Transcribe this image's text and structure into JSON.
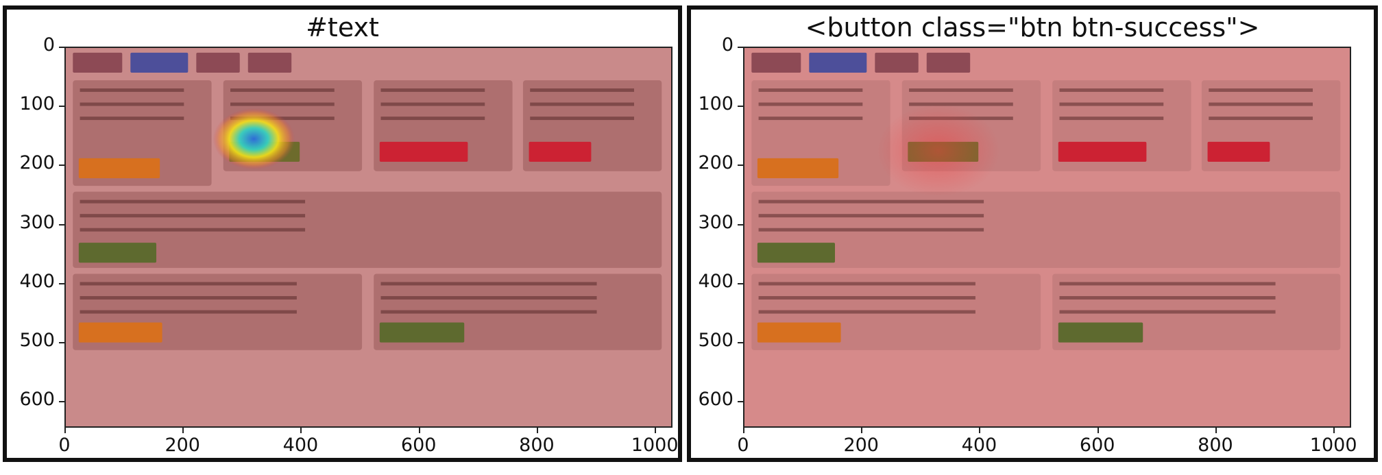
{
  "panels": [
    {
      "title": "#text",
      "tint": "#c98a8a",
      "card_fill": "#a96a6a",
      "hotspot": {
        "x": 320,
        "y": 155,
        "strength": "strong"
      }
    },
    {
      "title": "<button class=\"btn btn-success\">",
      "tint": "#d68a8a",
      "card_fill": "#c27b7b",
      "hotspot": {
        "x": 330,
        "y": 175,
        "strength": "faint"
      }
    }
  ],
  "axes": {
    "y_ticks": [
      "0",
      "100",
      "200",
      "300",
      "400",
      "500",
      "600"
    ],
    "x_ticks": [
      "0",
      "200",
      "400",
      "600",
      "800",
      "1000"
    ],
    "y_values": [
      0,
      100,
      200,
      300,
      400,
      500,
      600
    ],
    "x_values": [
      0,
      200,
      400,
      600,
      800,
      1000
    ],
    "xlim": [
      0,
      1030
    ],
    "ylim": [
      0,
      645
    ]
  },
  "screenshot": {
    "nav_buttons": [
      {
        "x": 12,
        "y": 8,
        "w": 84,
        "h": 34,
        "color": "#8d4a55"
      },
      {
        "x": 110,
        "y": 8,
        "w": 98,
        "h": 34,
        "color": "#4d4f9a"
      },
      {
        "x": 222,
        "y": 8,
        "w": 74,
        "h": 34,
        "color": "#8d4a55"
      },
      {
        "x": 310,
        "y": 8,
        "w": 74,
        "h": 34,
        "color": "#8d4a55"
      }
    ],
    "cards": [
      {
        "x": 12,
        "y": 55,
        "w": 236,
        "h": 180
      },
      {
        "x": 268,
        "y": 55,
        "w": 236,
        "h": 155
      },
      {
        "x": 524,
        "y": 55,
        "w": 236,
        "h": 155
      },
      {
        "x": 778,
        "y": 55,
        "w": 236,
        "h": 155
      },
      {
        "x": 12,
        "y": 245,
        "w": 1002,
        "h": 130
      },
      {
        "x": 12,
        "y": 385,
        "w": 492,
        "h": 130
      },
      {
        "x": 524,
        "y": 385,
        "w": 490,
        "h": 130
      }
    ],
    "card_buttons": [
      {
        "x": 22,
        "y": 188,
        "w": 138,
        "h": 34,
        "color": "#d7701f"
      },
      {
        "x": 278,
        "y": 160,
        "w": 120,
        "h": 34,
        "color": "#6d6b2c"
      },
      {
        "x": 534,
        "y": 160,
        "w": 150,
        "h": 34,
        "color": "#cc2233"
      },
      {
        "x": 788,
        "y": 160,
        "w": 106,
        "h": 34,
        "color": "#cc2233"
      },
      {
        "x": 22,
        "y": 332,
        "w": 132,
        "h": 34,
        "color": "#5e6a2f"
      },
      {
        "x": 22,
        "y": 468,
        "w": 142,
        "h": 34,
        "color": "#d7701f"
      },
      {
        "x": 534,
        "y": 468,
        "w": 144,
        "h": 34,
        "color": "#5e6a2f"
      }
    ]
  }
}
